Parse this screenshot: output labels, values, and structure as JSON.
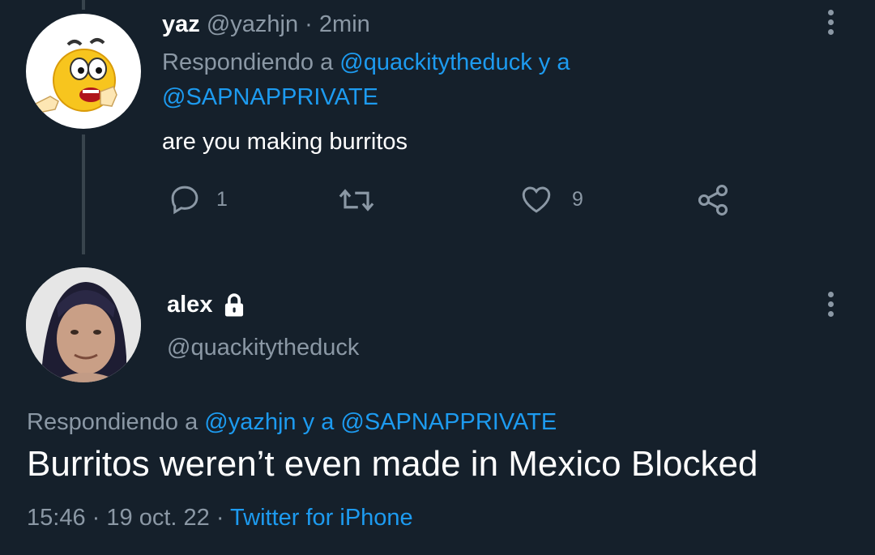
{
  "reply_tweet": {
    "display_name": "yaz",
    "handle": "@yazhjn",
    "separator": "·",
    "time": "2min",
    "replying_prefix": "Respondiendo a",
    "replying_to_1": "@quackitytheduck",
    "replying_joiner": "y a",
    "replying_to_2": "@SAPNAPPRIVATE",
    "text": "are you making burritos",
    "reply_count": "1",
    "like_count": "9"
  },
  "main_tweet": {
    "display_name": "alex",
    "handle": "@quackitytheduck",
    "replying_prefix": "Respondiendo a",
    "replying_to_1": "@yazhjn",
    "replying_joiner": "y a",
    "replying_to_2": "@SAPNAPPRIVATE",
    "text": "Burritos weren’t even made in Mexico Blocked",
    "time": "15:46",
    "dot": "·",
    "date": "19 oct. 22",
    "source": "Twitter for iPhone"
  },
  "colors": {
    "background": "#15202b",
    "link": "#1d9bf0",
    "muted": "#8b98a5"
  },
  "icons": [
    "reply-icon",
    "retweet-icon",
    "like-icon",
    "share-icon",
    "lock-icon",
    "more-icon"
  ]
}
